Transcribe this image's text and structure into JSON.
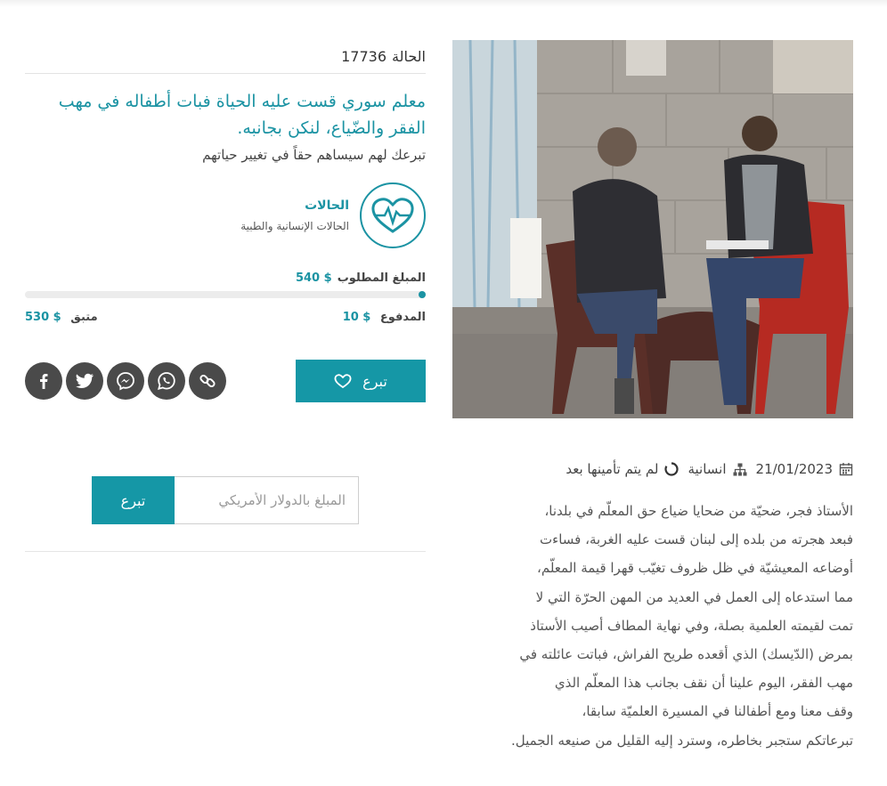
{
  "case": {
    "label": "الحالة",
    "number": "17736"
  },
  "title": "معلم سوري قست عليه الحياة فبات أطفاله في مهب الفقر والضّياع، لنكن بجانبه.",
  "subtitle": "تبرعك لهم سيساهم حقاً في تغيير حياتهم",
  "category": {
    "name": "الحالات",
    "description": "الحالات الإنسانية والطبية",
    "icon": "heart-pulse-icon"
  },
  "funding": {
    "needed_label": "المبلغ المطلوب",
    "needed": "540 $",
    "paid_label": "المدفوع",
    "paid": "10 $",
    "remaining_label": "متبق",
    "remaining": "530 $",
    "progress_fraction": 0.0185
  },
  "donate_button": "تبرع",
  "socials": [
    "facebook-icon",
    "twitter-icon",
    "messenger-icon",
    "whatsapp-icon",
    "link-icon"
  ],
  "donate_form": {
    "placeholder": "المبلغ بالدولار الأمريكي",
    "button": "تبرع"
  },
  "meta": {
    "date": "21/01/2023",
    "type": "انسانية",
    "status": "لم يتم تأمينها بعد"
  },
  "story_lines": [
    "الأستاذ فجر، ضحيّة من ضحايا ضياع حق المعلّم في بلدنا،",
    "فبعد هجرته من بلده إلى لبنان قست عليه الغربة، فساءت",
    "أوضاعه المعيشيّة في ظل ظروف تغيّب قهرا قيمة المعلّم،",
    "مما استدعاه إلى العمل في العديد من المهن الحرّة التي لا",
    "تمت لقيمته العلمية بصلة، وفي نهاية المطاف أصيب الأستاذ",
    "بمرض (الدّيسك) الذي أقعده طريح الفراش، فباتت عائلته في",
    "مهب الفقر، اليوم علينا أن نقف بجانب هذا المعلّم الذي",
    "وقف معنا ومع أطفالنا في المسيرة العلميّة سابقا،",
    "تبرعاتكم ستجبر بخاطره، وسترد إليه القليل من صنيعه الجميل."
  ],
  "colors": {
    "accent": "#1597a6",
    "social": "#4a4a4a"
  }
}
